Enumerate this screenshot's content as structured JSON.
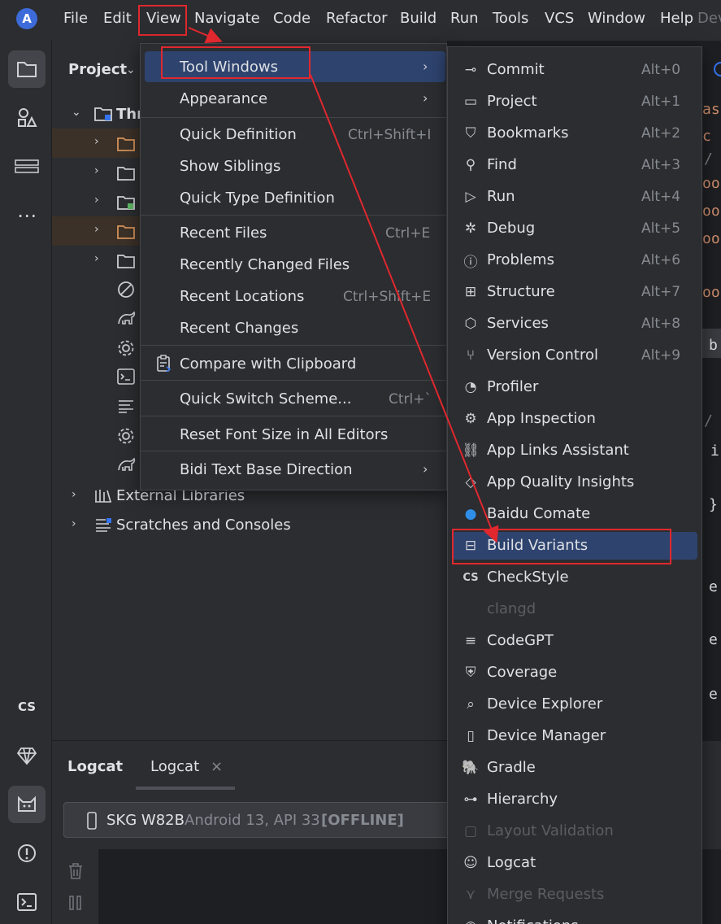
{
  "menubar": {
    "items": [
      "File",
      "Edit",
      "View",
      "Navigate",
      "Code",
      "Refactor",
      "Build",
      "Run",
      "Tools",
      "VCS",
      "Window",
      "Help"
    ],
    "window_title": "Dev"
  },
  "project": {
    "title": "Project",
    "root_label": "Thr",
    "external_libraries": "External Libraries",
    "scratches": "Scratches and Consoles"
  },
  "view_menu": {
    "items": [
      {
        "label": "Tool Windows",
        "shortcut": "",
        "submenu": true
      },
      {
        "label": "Appearance",
        "shortcut": "",
        "submenu": true
      },
      {
        "label": "Quick Definition",
        "shortcut": "Ctrl+Shift+I"
      },
      {
        "label": "Show Siblings",
        "shortcut": ""
      },
      {
        "label": "Quick Type Definition",
        "shortcut": ""
      },
      {
        "label": "Recent Files",
        "shortcut": "Ctrl+E"
      },
      {
        "label": "Recently Changed Files",
        "shortcut": ""
      },
      {
        "label": "Recent Locations",
        "shortcut": "Ctrl+Shift+E"
      },
      {
        "label": "Recent Changes",
        "shortcut": ""
      },
      {
        "label": "Compare with Clipboard",
        "shortcut": ""
      },
      {
        "label": "Quick Switch Scheme...",
        "shortcut": "Ctrl+`"
      },
      {
        "label": "Reset Font Size in All Editors",
        "shortcut": ""
      },
      {
        "label": "Bidi Text Base Direction",
        "shortcut": "",
        "submenu": true
      }
    ]
  },
  "tool_windows": {
    "items": [
      {
        "label": "Commit",
        "shortcut": "Alt+0",
        "icon": "commit-icon"
      },
      {
        "label": "Project",
        "shortcut": "Alt+1",
        "icon": "folder-icon"
      },
      {
        "label": "Bookmarks",
        "shortcut": "Alt+2",
        "icon": "bookmark-icon"
      },
      {
        "label": "Find",
        "shortcut": "Alt+3",
        "icon": "search-icon"
      },
      {
        "label": "Run",
        "shortcut": "Alt+4",
        "icon": "run-icon"
      },
      {
        "label": "Debug",
        "shortcut": "Alt+5",
        "icon": "bug-icon"
      },
      {
        "label": "Problems",
        "shortcut": "Alt+6",
        "icon": "problems-icon"
      },
      {
        "label": "Structure",
        "shortcut": "Alt+7",
        "icon": "structure-icon"
      },
      {
        "label": "Services",
        "shortcut": "Alt+8",
        "icon": "services-icon"
      },
      {
        "label": "Version Control",
        "shortcut": "Alt+9",
        "icon": "vcs-icon"
      },
      {
        "label": "Profiler",
        "shortcut": "",
        "icon": "profiler-icon"
      },
      {
        "label": "App Inspection",
        "shortcut": "",
        "icon": "app-inspection-icon"
      },
      {
        "label": "App Links Assistant",
        "shortcut": "",
        "icon": "app-links-icon"
      },
      {
        "label": "App Quality Insights",
        "shortcut": "",
        "icon": "diamond-icon"
      },
      {
        "label": "Baidu Comate",
        "shortcut": "",
        "icon": "comate-icon"
      },
      {
        "label": "Build Variants",
        "shortcut": "",
        "icon": "build-variants-icon"
      },
      {
        "label": "CheckStyle",
        "shortcut": "",
        "icon": "checkstyle-icon"
      },
      {
        "label": "clangd",
        "shortcut": "",
        "icon": "",
        "disabled": true
      },
      {
        "label": "CodeGPT",
        "shortcut": "",
        "icon": "codegpt-icon"
      },
      {
        "label": "Coverage",
        "shortcut": "",
        "icon": "shield-icon"
      },
      {
        "label": "Device Explorer",
        "shortcut": "",
        "icon": "device-explorer-icon"
      },
      {
        "label": "Device Manager",
        "shortcut": "",
        "icon": "device-manager-icon"
      },
      {
        "label": "Gradle",
        "shortcut": "",
        "icon": "gradle-icon"
      },
      {
        "label": "Hierarchy",
        "shortcut": "",
        "icon": "hierarchy-icon"
      },
      {
        "label": "Layout Validation",
        "shortcut": "",
        "icon": "layout-icon",
        "disabled": true
      },
      {
        "label": "Logcat",
        "shortcut": "",
        "icon": "logcat-icon"
      },
      {
        "label": "Merge Requests",
        "shortcut": "",
        "icon": "merge-icon",
        "disabled": true
      },
      {
        "label": "Notifications",
        "shortcut": "",
        "icon": "bell-icon"
      }
    ]
  },
  "logcat": {
    "title": "Logcat",
    "tab_label": "Logcat",
    "device_name": "SKG W82B",
    "device_info": "Android 13, API 33",
    "device_status": "[OFFLINE]"
  },
  "editor_fragments": [
    "as",
    "c",
    "/",
    "oo",
    "oo",
    "oo",
    "oo",
    "b",
    "/",
    "i",
    "}",
    "e",
    "e",
    "e"
  ],
  "colors": {
    "annotation_red": "#e0282e",
    "highlight_blue": "#2e436e",
    "menu_bg": "#2b2d30"
  }
}
